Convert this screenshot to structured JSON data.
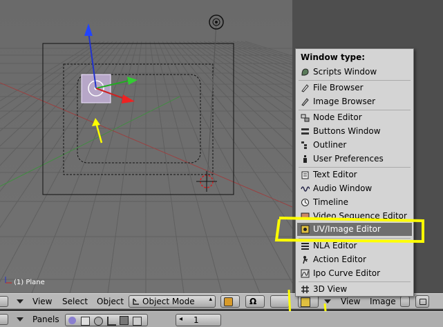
{
  "viewport": {
    "object_label": "(1) Plane"
  },
  "header_left": {
    "view_label": "View",
    "select_label": "Select",
    "object_label": "Object",
    "mode_value": "Object Mode"
  },
  "header_right": {
    "view_label": "View",
    "image_label": "Image"
  },
  "bottom_bar": {
    "panels_label": "Panels",
    "frame_value": "1"
  },
  "menu": {
    "title": "Window type:",
    "items": [
      {
        "label": "Scripts Window",
        "icon": "scripts-icon"
      },
      {
        "label": "File Browser",
        "icon": "file-browser-icon"
      },
      {
        "label": "Image Browser",
        "icon": "image-browser-icon"
      },
      {
        "label": "Node Editor",
        "icon": "node-editor-icon"
      },
      {
        "label": "Buttons Window",
        "icon": "buttons-window-icon"
      },
      {
        "label": "Outliner",
        "icon": "outliner-icon"
      },
      {
        "label": "User Preferences",
        "icon": "user-preferences-icon"
      },
      {
        "label": "Text Editor",
        "icon": "text-editor-icon"
      },
      {
        "label": "Audio Window",
        "icon": "audio-window-icon"
      },
      {
        "label": "Timeline",
        "icon": "timeline-icon"
      },
      {
        "label": "Video Sequence Editor",
        "icon": "video-sequence-icon"
      },
      {
        "label": "UV/Image Editor",
        "icon": "uv-image-editor-icon"
      },
      {
        "label": "NLA Editor",
        "icon": "nla-editor-icon"
      },
      {
        "label": "Action Editor",
        "icon": "action-editor-icon"
      },
      {
        "label": "Ipo Curve Editor",
        "icon": "ipo-curve-icon"
      },
      {
        "label": "3D View",
        "icon": "3d-view-icon"
      }
    ],
    "selected_index": 11
  },
  "colors": {
    "highlight": "#ffff00",
    "viewport_bg": "#6e6e6e",
    "menu_bg": "#d4d4d4",
    "menu_selected": "#6f6f6f"
  }
}
